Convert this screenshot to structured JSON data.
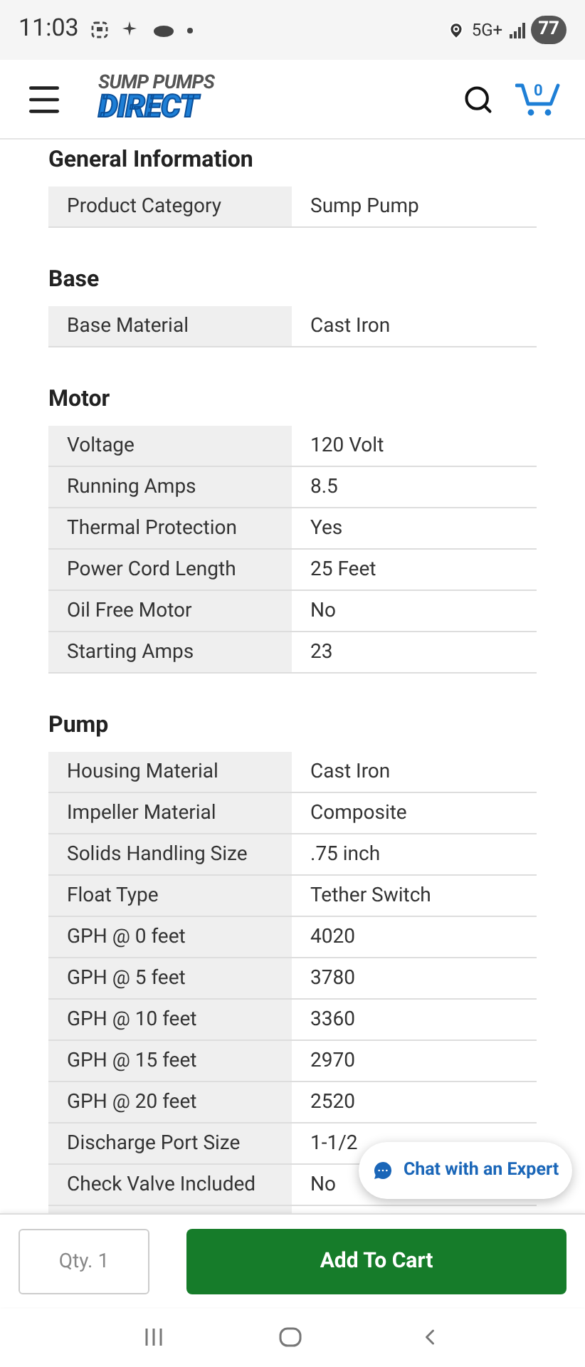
{
  "status_bar": {
    "time": "11:03",
    "network": "5G+",
    "battery": "77"
  },
  "header": {
    "logo_top": "SUMP PUMPS",
    "logo_bottom": "DIRECT",
    "cart_count": "0"
  },
  "sections": [
    {
      "title": "General Information",
      "rows": [
        {
          "label": "Product Category",
          "value": "Sump Pump"
        }
      ]
    },
    {
      "title": "Base",
      "rows": [
        {
          "label": "Base Material",
          "value": "Cast Iron"
        }
      ]
    },
    {
      "title": "Motor",
      "rows": [
        {
          "label": "Voltage",
          "value": "120 Volt"
        },
        {
          "label": "Running Amps",
          "value": "8.5"
        },
        {
          "label": "Thermal Protection",
          "value": "Yes"
        },
        {
          "label": "Power Cord Length",
          "value": "25 Feet"
        },
        {
          "label": "Oil Free Motor",
          "value": "No"
        },
        {
          "label": "Starting Amps",
          "value": "23"
        }
      ]
    },
    {
      "title": "Pump",
      "rows": [
        {
          "label": "Housing Material",
          "value": "Cast Iron"
        },
        {
          "label": "Impeller Material",
          "value": "Composite"
        },
        {
          "label": "Solids Handling Size",
          "value": ".75 inch"
        },
        {
          "label": "Float Type",
          "value": "Tether Switch"
        },
        {
          "label": "GPH @ 0 feet",
          "value": "4020"
        },
        {
          "label": "GPH @ 5 feet",
          "value": "3780"
        },
        {
          "label": "GPH @ 10 feet",
          "value": "3360"
        },
        {
          "label": "GPH @ 15 feet",
          "value": "2970"
        },
        {
          "label": "GPH @ 20 feet",
          "value": "2520"
        },
        {
          "label": "Discharge Port Size",
          "value": "1-1/2"
        },
        {
          "label": "Check Valve Included",
          "value": "No"
        },
        {
          "label": "",
          "value": ""
        }
      ]
    }
  ],
  "chat_button": {
    "label": "Chat with an Expert"
  },
  "quantity": {
    "placeholder": "Qty. 1"
  },
  "add_to_cart": {
    "label": "Add To Cart"
  }
}
